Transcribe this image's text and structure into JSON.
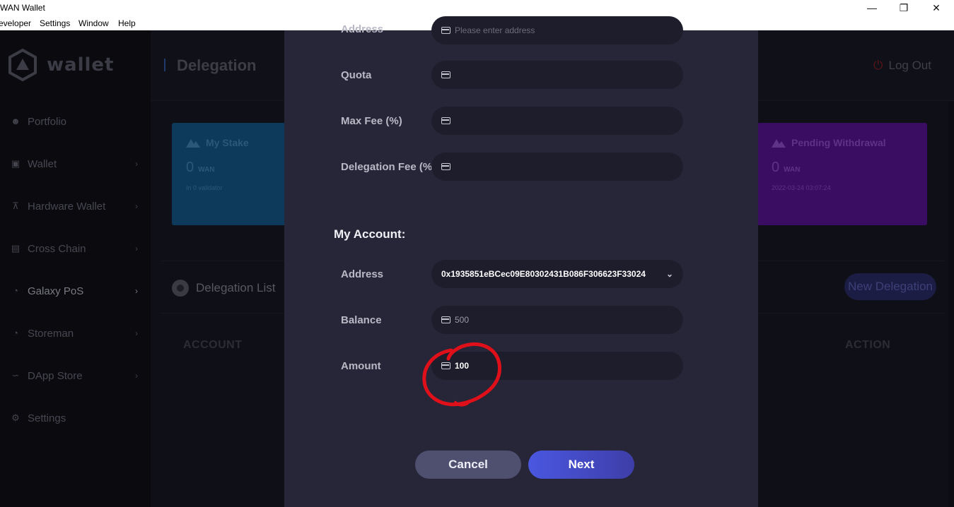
{
  "window": {
    "title": "WAN Wallet",
    "minimize": "—",
    "restore": "❐",
    "close": "✕"
  },
  "menu": [
    "eveloper",
    "Settings",
    "Window",
    "Help"
  ],
  "sidebar": {
    "logo_text": "wallet",
    "items": [
      {
        "label": "Portfolio",
        "icon": "person-icon",
        "chevron": false
      },
      {
        "label": "Wallet",
        "icon": "wallet-icon",
        "chevron": true
      },
      {
        "label": "Hardware Wallet",
        "icon": "hardware-icon",
        "chevron": true
      },
      {
        "label": "Cross Chain",
        "icon": "cross-chain-icon",
        "chevron": true
      },
      {
        "label": "Galaxy PoS",
        "icon": "pie-icon",
        "chevron": true
      },
      {
        "label": "Storeman",
        "icon": "storeman-icon",
        "chevron": true
      },
      {
        "label": "DApp Store",
        "icon": "chart-icon",
        "chevron": true
      },
      {
        "label": "Settings",
        "icon": "gear-icon",
        "chevron": false
      }
    ]
  },
  "header": {
    "title": "Delegation",
    "logout": "Log Out"
  },
  "cards": {
    "stake": {
      "title": "My Stake",
      "value": "0",
      "unit": "WAN",
      "sub": "In 0 validator"
    },
    "pending": {
      "title": "Pending Withdrawal",
      "value": "0",
      "unit": "WAN",
      "sub": "2022-03-24 03:07:24"
    }
  },
  "list": {
    "title": "Delegation List",
    "new_button": "New Delegation",
    "columns": {
      "account": "ACCOUNT",
      "action": "ACTION"
    }
  },
  "modal": {
    "validator_fields": [
      {
        "label": "Address",
        "value": "",
        "placeholder": "Please enter address"
      },
      {
        "label": "Quota",
        "value": ""
      },
      {
        "label": "Max Fee (%)",
        "value": ""
      },
      {
        "label": "Delegation Fee (%)",
        "value": ""
      }
    ],
    "my_account_title": "My Account:",
    "account": {
      "address_label": "Address",
      "address_value": "0x1935851eBCec09E80302431B086F306623F33024",
      "balance_label": "Balance",
      "balance_value": "500",
      "amount_label": "Amount",
      "amount_value": "100"
    },
    "cancel": "Cancel",
    "next": "Next"
  },
  "colors": {
    "modal_bg": "#272638",
    "field_bg": "#1e1d2b",
    "next_button": "#4a57e0",
    "cancel_button": "#4f4f70",
    "annotation": "#e0101a"
  }
}
